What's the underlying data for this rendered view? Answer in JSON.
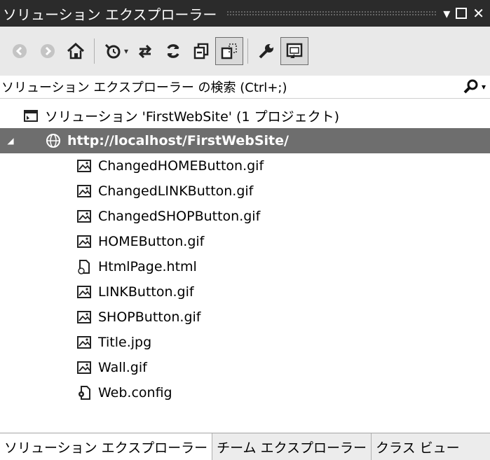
{
  "title_bar": {
    "title": "ソリューション エクスプローラー",
    "dropdown_glyph": "▾",
    "close_glyph": "✕"
  },
  "toolbar": {
    "buttons": [
      {
        "name": "back",
        "icon": "circle-arrow-left-icon"
      },
      {
        "name": "forward",
        "icon": "circle-arrow-right-icon"
      },
      {
        "name": "home",
        "icon": "home-icon"
      },
      {
        "name": "pending-changes-filter",
        "icon": "history-clock-icon"
      },
      {
        "name": "sync-with-active-document",
        "icon": "sync-arrows-icon"
      },
      {
        "name": "refresh",
        "icon": "refresh-icon"
      },
      {
        "name": "collapse-all",
        "icon": "collapse-all-icon"
      },
      {
        "name": "show-all-files",
        "icon": "show-all-files-icon",
        "pressed": true
      },
      {
        "name": "properties",
        "icon": "wrench-icon"
      },
      {
        "name": "preview-selected-items",
        "icon": "preview-icon",
        "pressed": true
      }
    ],
    "dropdown_glyph": "▾"
  },
  "search": {
    "placeholder": "ソリューション エクスプローラー の検索 (Ctrl+;)",
    "icon": "search-icon",
    "dropdown_glyph": "▾"
  },
  "tree": {
    "solution": "ソリューション 'FirstWebSite' (1 プロジェクト)",
    "website": "http://localhost/FirstWebSite/",
    "expander_glyph": "◢",
    "files": [
      {
        "name": "ChangedHOMEButton.gif",
        "icon": "image-file-icon"
      },
      {
        "name": "ChangedLINKButton.gif",
        "icon": "image-file-icon"
      },
      {
        "name": "ChangedSHOPButton.gif",
        "icon": "image-file-icon"
      },
      {
        "name": "HOMEButton.gif",
        "icon": "image-file-icon"
      },
      {
        "name": "HtmlPage.html",
        "icon": "html-file-icon"
      },
      {
        "name": "LINKButton.gif",
        "icon": "image-file-icon"
      },
      {
        "name": "SHOPButton.gif",
        "icon": "image-file-icon"
      },
      {
        "name": "Title.jpg",
        "icon": "image-file-icon"
      },
      {
        "name": "Wall.gif",
        "icon": "image-file-icon"
      },
      {
        "name": "Web.config",
        "icon": "config-file-icon"
      }
    ]
  },
  "bottom_tabs": [
    {
      "label": "ソリューション エクスプローラー",
      "active": true
    },
    {
      "label": "チーム エクスプローラー",
      "active": false
    },
    {
      "label": "クラス ビュー",
      "active": false
    }
  ]
}
